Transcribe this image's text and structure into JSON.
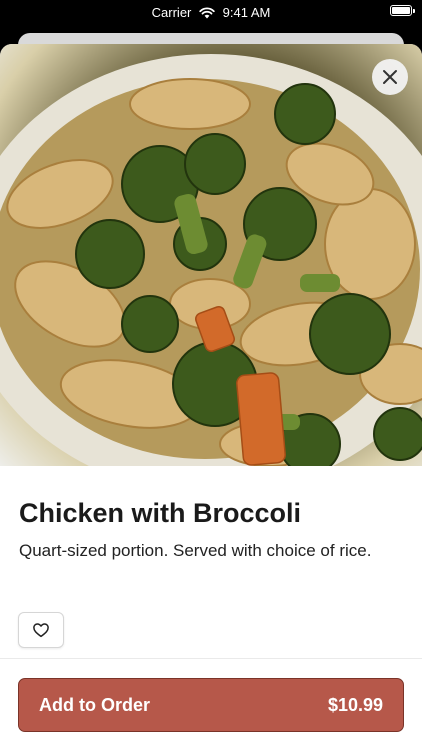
{
  "status_bar": {
    "carrier": "Carrier",
    "time": "9:41 AM"
  },
  "item": {
    "image_icon": "food-photo",
    "title": "Chicken with Broccoli",
    "description": "Quart-sized portion. Served with choice of rice."
  },
  "actions": {
    "close_icon": "close-icon",
    "favorite_icon": "heart-icon",
    "order_label": "Add to Order",
    "order_price": "$10.99"
  },
  "colors": {
    "accent": "#b6584a",
    "accent_border": "#7a3328"
  }
}
